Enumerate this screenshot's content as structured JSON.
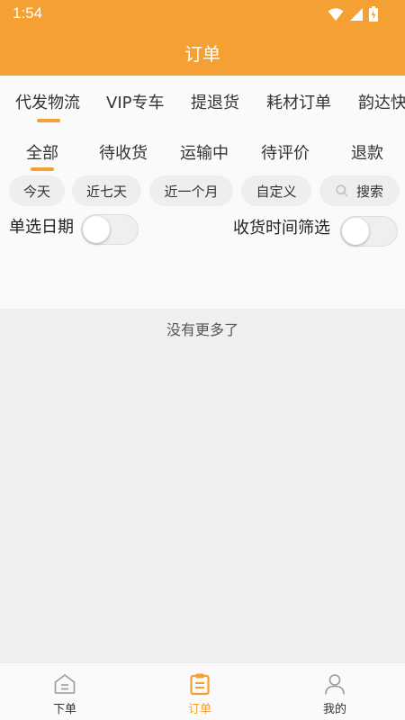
{
  "status_bar": {
    "time": "1:54"
  },
  "app_bar": {
    "title": "订单"
  },
  "top_tabs": [
    "代发物流",
    "VIP专车",
    "提退货",
    "耗材订单",
    "韵达快"
  ],
  "sub_tabs": [
    "全部",
    "待收货",
    "运输中",
    "待评价",
    "退款"
  ],
  "filters": {
    "chips": [
      "今天",
      "近七天",
      "近一个月",
      "自定义"
    ],
    "search_label": "搜索"
  },
  "toggles": {
    "single_date_label": "单选日期",
    "receive_time_label": "收货时间筛选"
  },
  "list": {
    "empty_text": "没有更多了"
  },
  "bottom_nav": [
    {
      "label": "下单",
      "icon": "home-icon"
    },
    {
      "label": "订单",
      "icon": "clipboard-icon"
    },
    {
      "label": "我的",
      "icon": "person-icon"
    }
  ],
  "colors": {
    "accent": "#f5a033",
    "background": "#efeff2",
    "surface": "#fafafa"
  }
}
